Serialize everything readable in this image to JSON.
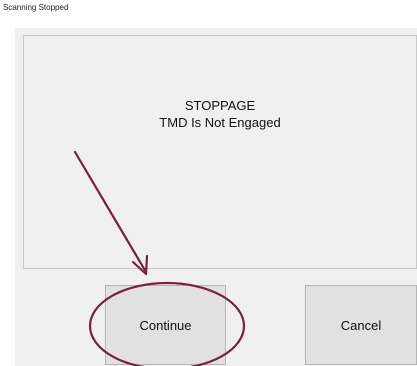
{
  "window": {
    "title": "Scanning Stopped"
  },
  "message": {
    "heading": "STOPPAGE",
    "subtext": "TMD Is Not Engaged"
  },
  "buttons": {
    "continue_label": "Continue",
    "cancel_label": "Cancel"
  },
  "annotation": {
    "color": "#7a1f3d"
  }
}
